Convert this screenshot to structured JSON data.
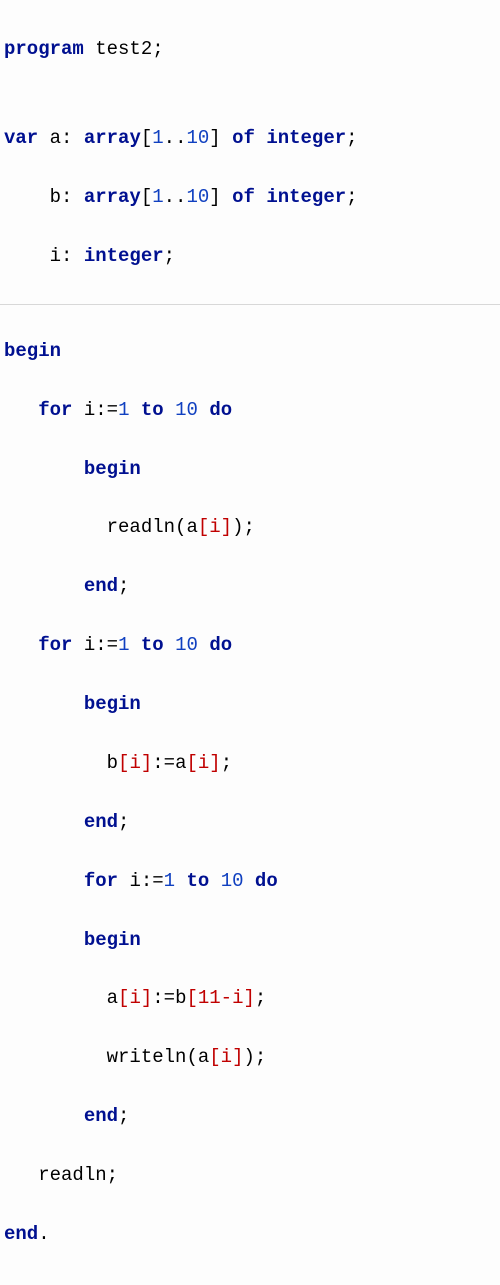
{
  "code": {
    "l1": {
      "kw1": "program",
      "id": " test2",
      "p": ";"
    },
    "l2": "",
    "l3": {
      "kw1": "var",
      "sp": " ",
      "id1": "a",
      "p1": ": ",
      "kw2": "array",
      "p2": "[",
      "n1": "1",
      "p3": "..",
      "n2": "10",
      "p4": "] ",
      "kw3": "of",
      "sp2": " ",
      "kw4": "integer",
      "p5": ";"
    },
    "l4": {
      "sp": "    ",
      "id1": "b",
      "p1": ": ",
      "kw2": "array",
      "p2": "[",
      "n1": "1",
      "p3": "..",
      "n2": "10",
      "p4": "] ",
      "kw3": "of",
      "sp2": " ",
      "kw4": "integer",
      "p5": ";"
    },
    "l5": {
      "sp": "    ",
      "id1": "i",
      "p1": ": ",
      "kw2": "integer",
      "p2": ";"
    },
    "l6": "",
    "l7": {
      "kw": "begin"
    },
    "l8": {
      "sp": "   ",
      "kw1": "for",
      "sp2": " ",
      "id1": "i",
      "p1": ":=",
      "n1": "1",
      "sp3": " ",
      "kw2": "to",
      "sp4": " ",
      "n2": "10",
      "sp5": " ",
      "kw3": "do"
    },
    "l9": {
      "sp": "       ",
      "kw": "begin"
    },
    "l10": {
      "sp": "         ",
      "fn": "readln",
      "p1": "(",
      "id": "a",
      "br1": "[",
      "idx": "i",
      "br2": "]",
      "p2": ")",
      "p3": ";"
    },
    "l11": {
      "sp": "       ",
      "kw": "end",
      "p": ";"
    },
    "l12": {
      "sp": "   ",
      "kw1": "for",
      "sp2": " ",
      "id1": "i",
      "p1": ":=",
      "n1": "1",
      "sp3": " ",
      "kw2": "to",
      "sp4": " ",
      "n2": "10",
      "sp5": " ",
      "kw3": "do"
    },
    "l13": {
      "sp": "       ",
      "kw": "begin"
    },
    "l14": {
      "sp": "         ",
      "id1": "b",
      "br1": "[",
      "idx1": "i",
      "br2": "]",
      "p1": ":=",
      "id2": "a",
      "br3": "[",
      "idx2": "i",
      "br4": "]",
      "p2": ";"
    },
    "l15": {
      "sp": "       ",
      "kw": "end",
      "p": ";"
    },
    "l16": {
      "sp": "       ",
      "kw1": "for",
      "sp2": " ",
      "id1": "i",
      "p1": ":=",
      "n1": "1",
      "sp3": " ",
      "kw2": "to",
      "sp4": " ",
      "n2": "10",
      "sp5": " ",
      "kw3": "do"
    },
    "l17": {
      "sp": "       ",
      "kw": "begin"
    },
    "l18": {
      "sp": "         ",
      "id1": "a",
      "br1": "[",
      "idx1": "i",
      "br2": "]",
      "p1": ":=",
      "id2": "b",
      "br3": "[",
      "expr": "11-i",
      "br4": "]",
      "p2": ";"
    },
    "l19": {
      "sp": "         ",
      "fn": "writeln",
      "p1": "(",
      "id": "a",
      "br1": "[",
      "idx": "i",
      "br2": "]",
      "p2": ")",
      "p3": ";"
    },
    "l20": {
      "sp": "       ",
      "kw": "end",
      "p": ";"
    },
    "l21": {
      "sp": "   ",
      "fn": "readln",
      "p": ";"
    },
    "l22": {
      "kw": "end",
      "p": "."
    }
  }
}
